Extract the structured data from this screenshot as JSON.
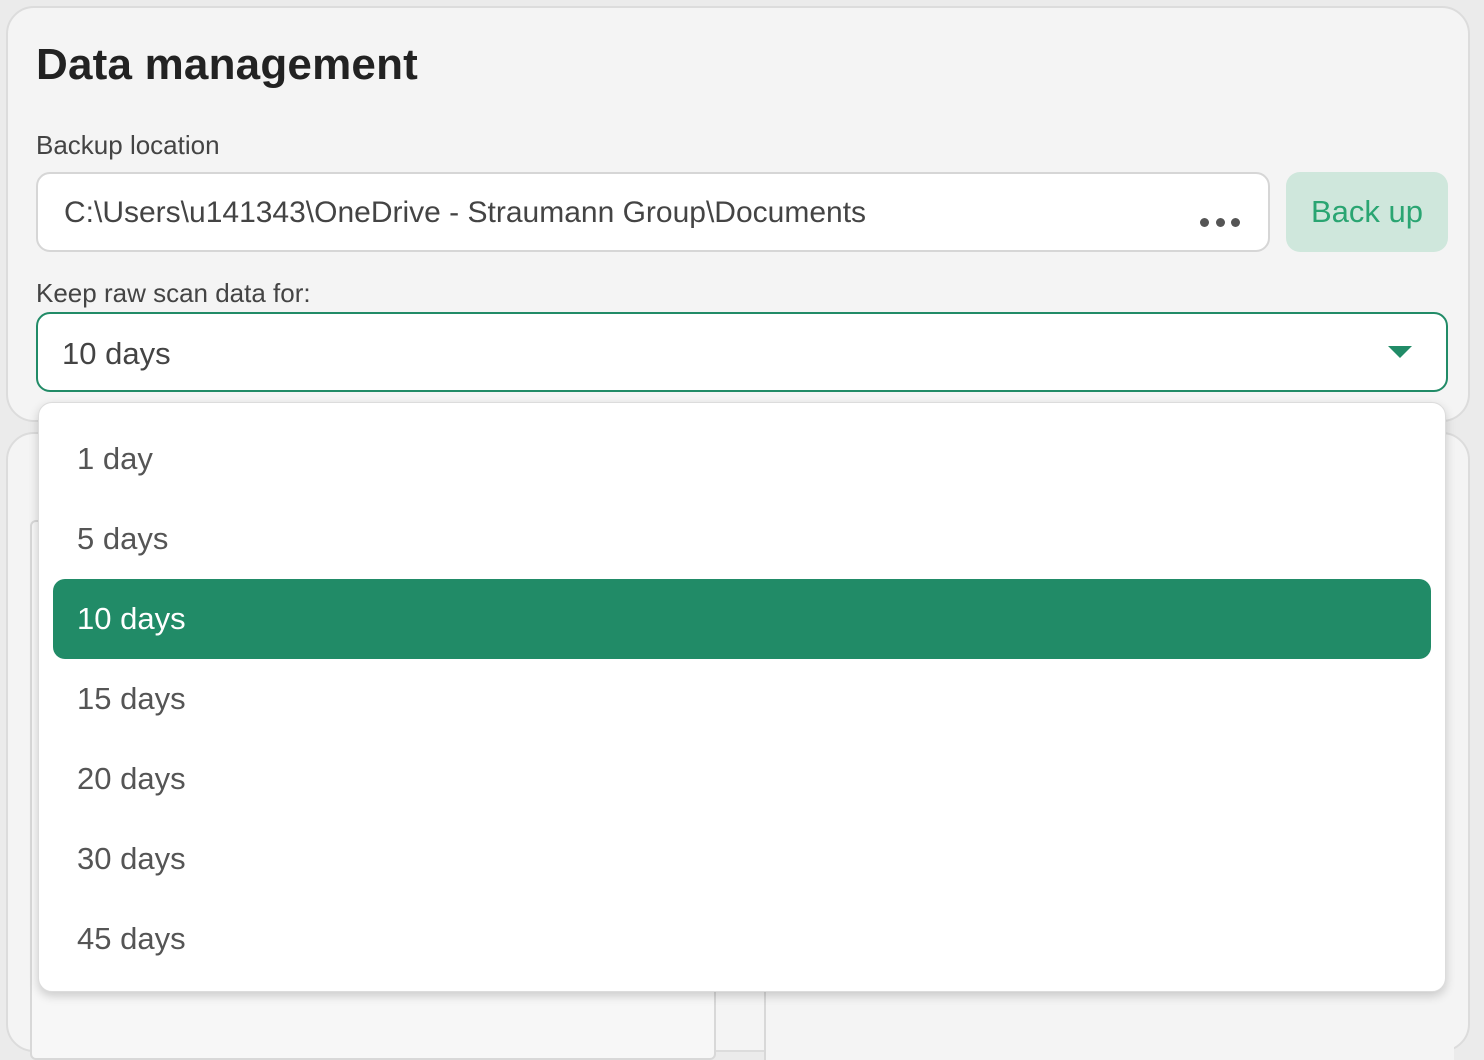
{
  "section": {
    "title": "Data management",
    "backup_label": "Backup location",
    "backup_path": "C:\\Users\\u141343\\OneDrive - Straumann Group\\Documents",
    "browse_icon": "more-horizontal-icon",
    "backup_button": "Back up",
    "keep_label": "Keep raw scan data for:",
    "keep_value": "10 days"
  },
  "dropdown": {
    "options": [
      "1 day",
      "5 days",
      "10 days",
      "15 days",
      "20 days",
      "30 days",
      "45 days"
    ],
    "selected_index": 2
  },
  "colors": {
    "accent": "#218b67",
    "backup_button_bg": "#cfe7dc",
    "backup_button_text": "#2aa572"
  }
}
